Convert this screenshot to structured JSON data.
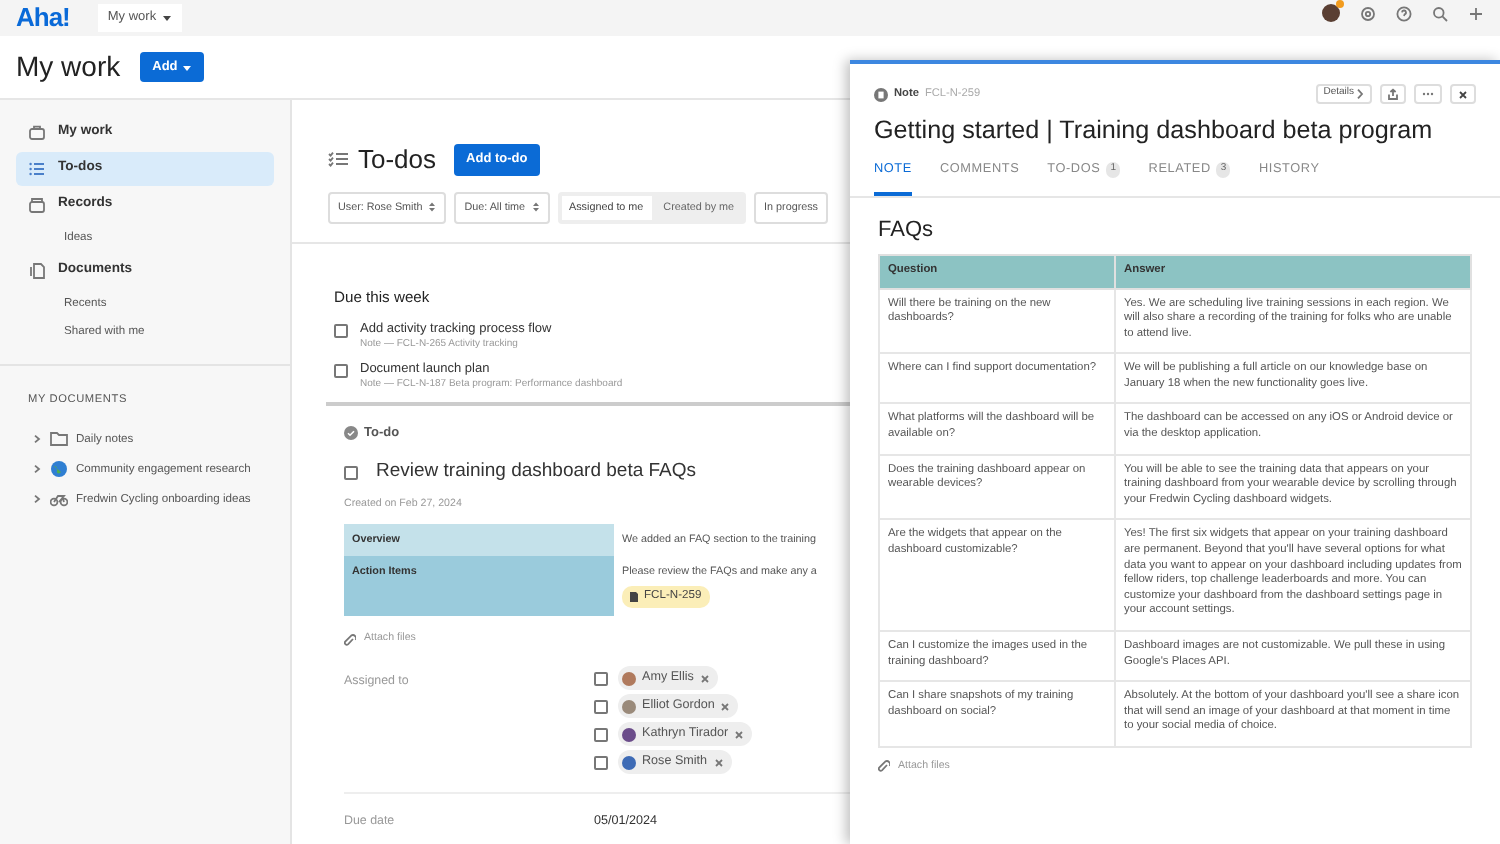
{
  "topbar": {
    "logo": "Aha!",
    "workspace": "My work"
  },
  "header": {
    "title": "My work",
    "add_button": "Add"
  },
  "sidebar": {
    "items": [
      {
        "kind": "briefcase",
        "label": "My work",
        "selected": false
      },
      {
        "kind": "list",
        "label": "To-dos",
        "selected": true
      },
      {
        "kind": "records",
        "label": "Records",
        "selected": false,
        "children": [
          {
            "label": "Ideas"
          }
        ]
      },
      {
        "kind": "documents",
        "label": "Documents",
        "selected": false,
        "children": [
          {
            "label": "Recents"
          },
          {
            "label": "Shared with me"
          }
        ]
      }
    ],
    "section_title": "MY DOCUMENTS",
    "documents": [
      {
        "kind": "folder",
        "label": "Daily notes",
        "expanded": false
      },
      {
        "kind": "globe",
        "label": "Community engagement research",
        "expanded": false
      },
      {
        "kind": "bike",
        "label": "Fredwin Cycling onboarding ideas",
        "expanded": false
      }
    ]
  },
  "todos": {
    "title": "To-dos",
    "add_button": "Add to-do",
    "filters": [
      {
        "kind": "select",
        "label": "User: Rose Smith"
      },
      {
        "kind": "select",
        "label": "Due: All time"
      },
      {
        "kind": "toggle",
        "options": [
          {
            "label": "Assigned to me",
            "selected": true
          },
          {
            "label": "Created by me",
            "selected": false
          }
        ]
      },
      {
        "kind": "plain",
        "label": "In progress"
      }
    ],
    "section": "Due this week",
    "tasks": [
      {
        "title": "Add activity tracking process flow",
        "subtitle": "Note — FCL-N-265 Activity tracking",
        "checked": false
      },
      {
        "title": "Document launch plan",
        "subtitle": "Note — FCL-N-187 Beta program: Performance dashboard",
        "checked": false
      }
    ]
  },
  "detail": {
    "status": "To-do",
    "title": "Review training dashboard beta FAQs",
    "checked": false,
    "created": "Created on Feb 27, 2024",
    "table": [
      {
        "label": "Overview",
        "value": "We added an FAQ section to the training"
      },
      {
        "label": "Action Items",
        "value": "Please review the FAQs and make any a",
        "tag": "FCL-N-259"
      }
    ],
    "attach": "Attach files",
    "assigned_label": "Assigned to",
    "assignees": [
      {
        "name": "Amy Ellis",
        "checked": false
      },
      {
        "name": "Elliot Gordon",
        "checked": false
      },
      {
        "name": "Kathryn Tirador",
        "checked": false
      },
      {
        "name": "Rose Smith",
        "checked": false
      }
    ],
    "due_label": "Due date",
    "due": "05/01/2024"
  },
  "panel": {
    "type": "Note",
    "id": "FCL-N-259",
    "details_button": "Details",
    "title": "Getting started | Training dashboard beta program",
    "tabs": [
      {
        "label": "NOTE",
        "selected": true
      },
      {
        "label": "COMMENTS",
        "selected": false
      },
      {
        "label": "TO-DOS",
        "count": "1",
        "selected": false
      },
      {
        "label": "RELATED",
        "count": "3",
        "selected": false
      },
      {
        "label": "HISTORY",
        "selected": false
      }
    ],
    "heading": "FAQs",
    "columns": [
      "Question",
      "Answer"
    ],
    "rows": [
      [
        "Will there be training on the new dashboards?",
        "Yes. We are scheduling live training sessions in each region. We will also share a recording of the training for folks who are unable to attend live."
      ],
      [
        "Where can I find support documentation?",
        "We will be publishing a full article on our knowledge base on January 18 when the new functionality goes live."
      ],
      [
        "What platforms will the dashboard will be available on?",
        "The dashboard can be accessed on any iOS or Android device or via the desktop application."
      ],
      [
        "Does the training dashboard appear on wearable devices?",
        "You will be able to see the training data that appears on your training dashboard from your wearable device by scrolling through your Fredwin Cycling dashboard widgets."
      ],
      [
        "Are the widgets that appear on the dashboard customizable?",
        "Yes! The first six widgets that appear on your training dashboard are permanent. Beyond that you'll have several options for what data you want to appear on your dashboard including updates from fellow riders, top challenge leaderboards and more. You can customize your dashboard from the dashboard settings page in your account settings."
      ],
      [
        "Can I customize the images used in the training dashboard?",
        "Dashboard images are not customizable. We pull these in using Google's Places API."
      ],
      [
        "Can I share snapshots of my training dashboard on social?",
        "Absolutely. At the bottom of your dashboard you'll see a share icon that will send an image of your dashboard at that moment in time to your social media of choice."
      ]
    ],
    "attach": "Attach files"
  }
}
